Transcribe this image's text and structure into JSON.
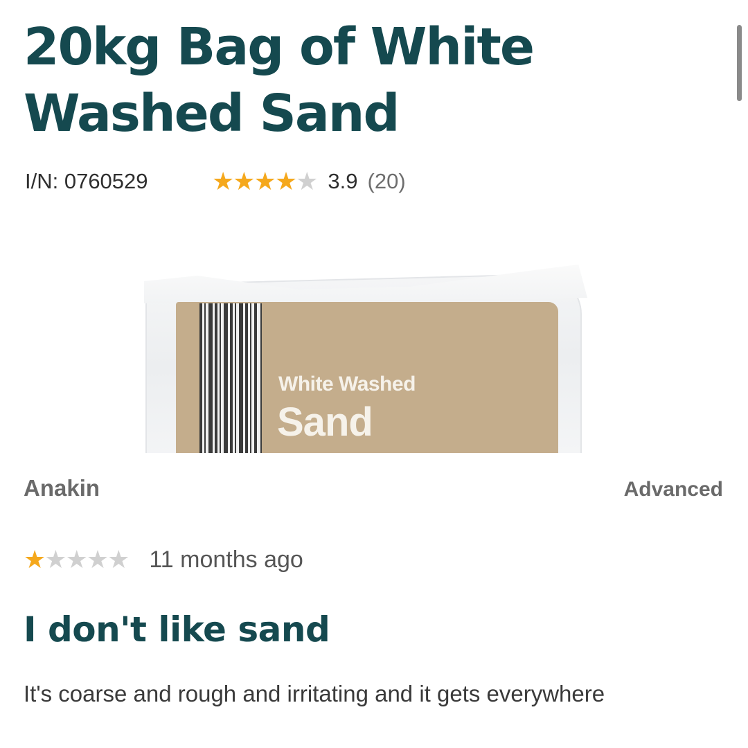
{
  "product": {
    "title": "20kg Bag of White Washed Sand",
    "item_number": "I/N: 0760529",
    "rating": {
      "stars_filled": 4,
      "stars_total": 5,
      "value": "3.9",
      "count": "(20)"
    },
    "image": {
      "label_line1": "White Washed",
      "label_line2": "Sand"
    }
  },
  "review": {
    "author": "Anakin",
    "level": "Advanced",
    "stars_filled": 1,
    "stars_total": 5,
    "date": "11 months ago",
    "title": "I don't like sand",
    "body": "It's coarse and rough and irritating and it gets everywhere"
  },
  "colors": {
    "title": "#15494f",
    "star_filled": "#f5a81c",
    "star_empty": "#d0d0d0",
    "bag_label": "#c4ad8c"
  }
}
